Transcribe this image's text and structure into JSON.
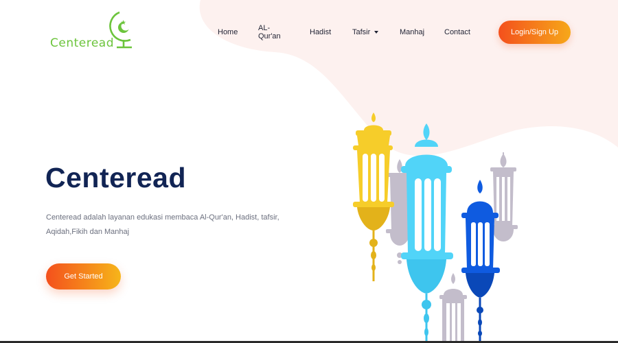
{
  "brand": {
    "name": "Centeread",
    "logo_color": "#6cc43c"
  },
  "nav": {
    "items": [
      {
        "label": "Home"
      },
      {
        "label": "AL-Qur'an"
      },
      {
        "label": "Hadist"
      },
      {
        "label": "Tafsir",
        "has_dropdown": true
      },
      {
        "label": "Manhaj"
      },
      {
        "label": "Contact"
      }
    ],
    "login_label": "Login/Sign Up"
  },
  "hero": {
    "title": "Centeread",
    "description": "Centeread adalah layanan edukasi membaca Al-Qur'an, Hadist, tafsir, Aqidah,Fikih dan Manhaj",
    "cta_label": "Get Started"
  },
  "colors": {
    "accent_start": "#f4501c",
    "accent_end": "#f6a81a",
    "title": "#112454",
    "blob": "#fdf1ef",
    "lantern_yellow": "#f6cd2a",
    "lantern_cyan": "#51d4f8",
    "lantern_blue": "#0f5be0",
    "lantern_grey": "#c3bdcb"
  },
  "icons": {
    "logo_mark": "crescent-star-icon",
    "dropdown": "caret-down-icon",
    "illustration": "ramadan-lanterns-illustration"
  }
}
